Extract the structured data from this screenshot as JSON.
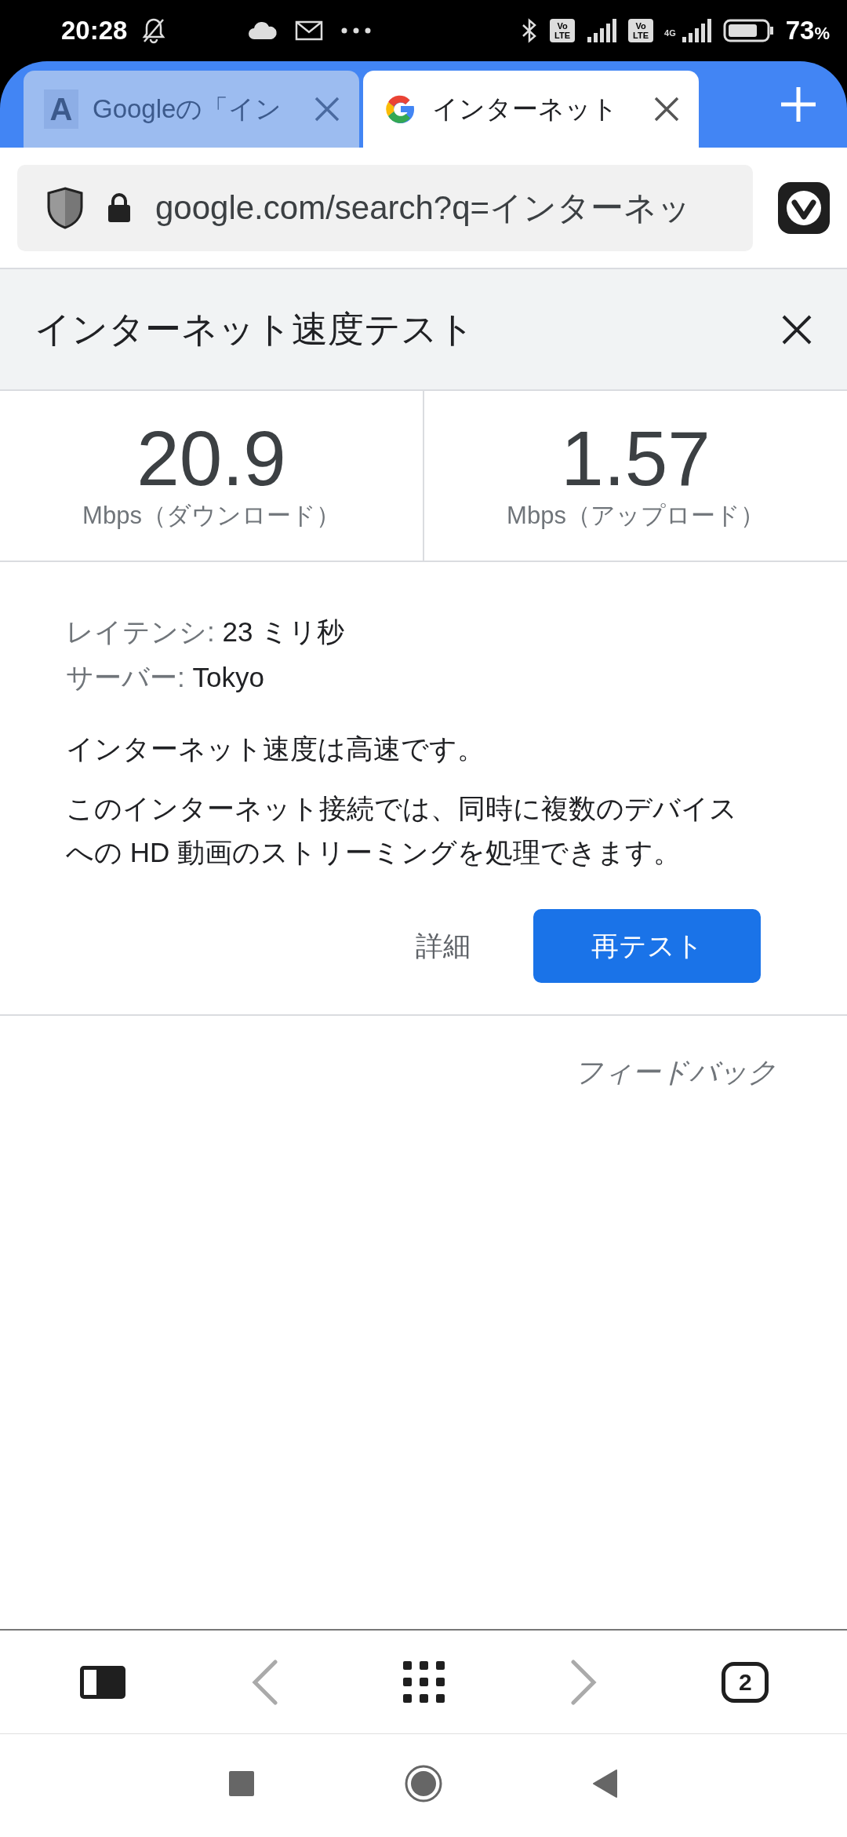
{
  "status_bar": {
    "time": "20:28",
    "sims": [
      {
        "badge_top": "Vo",
        "badge_bottom": "LTE"
      },
      {
        "badge_top": "Vo",
        "badge_bottom": "LTE",
        "network": "4G"
      }
    ],
    "battery_value": "73",
    "battery_unit": "%"
  },
  "tabs": [
    {
      "title": "Googleの「イン",
      "selected": false,
      "favicon": {
        "kind": "letter",
        "letter": "A"
      }
    },
    {
      "title": "インターネット",
      "selected": true,
      "favicon": {
        "kind": "google"
      }
    }
  ],
  "address_bar": {
    "url": "google.com/search?q=インターネッ"
  },
  "speed_test": {
    "title": "インターネット速度テスト",
    "results": [
      {
        "value": "20.9",
        "unit": "Mbps（ダウンロード）"
      },
      {
        "value": "1.57",
        "unit": "Mbps（アップロード）"
      }
    ],
    "details": [
      {
        "label": "レイテンシ:",
        "value": "23 ミリ秒"
      },
      {
        "label": "サーバー:",
        "value": "Tokyo"
      }
    ],
    "summary": "インターネット速度は高速です。",
    "description": "このインターネット接続では、同時に複数のデバイスへの HD 動画のストリーミングを処理できます。",
    "buttons": [
      {
        "label": "詳細",
        "kind": "text"
      },
      {
        "label": "再テスト",
        "kind": "primary"
      }
    ],
    "feedback": "フィードバック"
  },
  "toolbar": {
    "back_enabled": false,
    "forward_enabled": false,
    "tab_count": "2"
  }
}
